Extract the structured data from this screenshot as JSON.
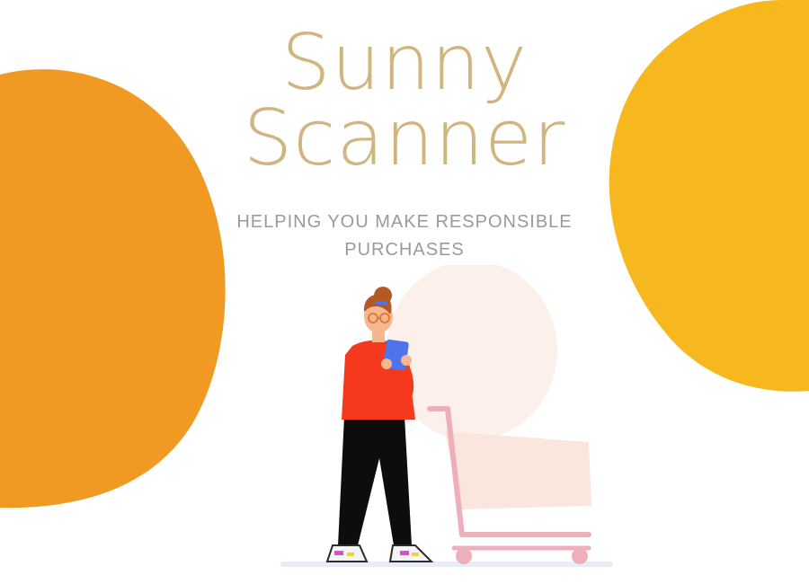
{
  "hero": {
    "title_line1": "Sunny",
    "title_line2": "Scanner",
    "subtitle": "HELPING YOU MAKE RESPONSIBLE PURCHASES"
  },
  "colors": {
    "title": "#d1b57f",
    "subtitle": "#9a9a9a",
    "left_blob": "#f09a24",
    "right_blob": "#f7b71e",
    "cart": "#eeaebb",
    "shirt": "#f5391e",
    "pants": "#0d0d0d",
    "tablet": "#4f73ea",
    "hair": "#b35a24"
  },
  "icons": {
    "illustration": "woman-with-tablet-and-shopping-cart"
  }
}
